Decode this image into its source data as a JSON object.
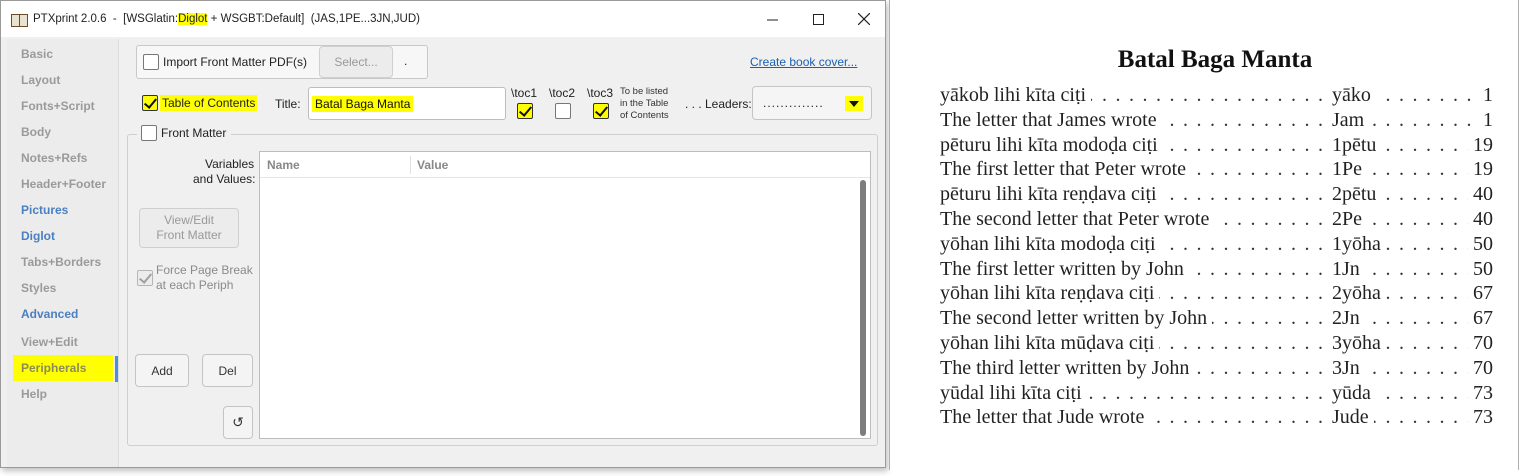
{
  "window": {
    "title_prefix": "PTXprint 2.0.6  -  [WSGlatin:",
    "title_highlight": "Diglot",
    "title_suffix": " + WSGBT:Default]  (JAS,1PE...3JN,JUD)"
  },
  "sidebar": {
    "items": [
      {
        "label": "Basic"
      },
      {
        "label": "Layout"
      },
      {
        "label": "Fonts+Script"
      },
      {
        "label": "Body"
      },
      {
        "label": "Notes+Refs"
      },
      {
        "label": "Header+Footer"
      },
      {
        "label": "Pictures"
      },
      {
        "label": "Diglot"
      },
      {
        "label": "Tabs+Borders"
      },
      {
        "label": "Styles"
      },
      {
        "label": "Advanced"
      },
      {
        "label": "View+Edit"
      },
      {
        "label": "Peripherals"
      },
      {
        "label": "Help"
      }
    ]
  },
  "peripherals": {
    "import_label": "Import Front Matter PDF(s)",
    "select_button": "Select...",
    "select_path": ".",
    "create_cover_link": "Create book cover...",
    "toc_label": "Table of Contents",
    "title_label": "Title:",
    "title_value": "Batal Baga Manta",
    "toc1_label": "\\toc1",
    "toc2_label": "\\toc2",
    "toc3_label": "\\toc3",
    "toc_note": [
      "To be listed",
      "in the Table",
      "of Contents"
    ],
    "leaders_label": ". . . Leaders:",
    "leaders_value": "..............",
    "front_matter_label": "Front Matter",
    "variables_label": [
      "Variables",
      "and Values:"
    ],
    "view_edit_button": [
      "View/Edit",
      "Front Matter"
    ],
    "force_break_label": [
      "Force Page Break",
      "at each Periph"
    ],
    "add_button": "Add",
    "del_button": "Del",
    "refresh_icon": "↺",
    "table_headers": [
      "Name",
      "Value"
    ]
  },
  "preview": {
    "title": "Batal Baga Manta",
    "toc": [
      {
        "title": "yākob lihi kīta ciṭi",
        "abbr": "yāko",
        "page": "1"
      },
      {
        "title": "The letter that James wrote",
        "abbr": "Jam",
        "page": "1"
      },
      {
        "title": "pēturu lihi kīta modoḍa ciṭi",
        "abbr": "1pētu",
        "page": "19"
      },
      {
        "title": "The first letter that Peter wrote",
        "abbr": "1Pe",
        "page": "19"
      },
      {
        "title": "pēturu lihi kīta reṇḍava ciṭi",
        "abbr": "2pētu",
        "page": "40"
      },
      {
        "title": "The second letter that Peter wrote",
        "abbr": "2Pe",
        "page": "40"
      },
      {
        "title": "yōhan lihi kīta modoḍa ciṭi",
        "abbr": "1yōha",
        "page": "50"
      },
      {
        "title": "The first letter written by John",
        "abbr": "1Jn",
        "page": "50"
      },
      {
        "title": "yōhan lihi kīta reṇḍava ciṭi",
        "abbr": "2yōha",
        "page": "67"
      },
      {
        "title": "The second letter written by John",
        "abbr": "2Jn",
        "page": "67"
      },
      {
        "title": "yōhan lihi kīta mūḍava ciṭi",
        "abbr": "3yōha",
        "page": "70"
      },
      {
        "title": "The third letter written by John",
        "abbr": "3Jn",
        "page": "70"
      },
      {
        "title": "yūdal lihi kīta ciṭi",
        "abbr": "yūda",
        "page": "73"
      },
      {
        "title": "The letter that Jude wrote",
        "abbr": "Jude",
        "page": "73"
      }
    ]
  }
}
